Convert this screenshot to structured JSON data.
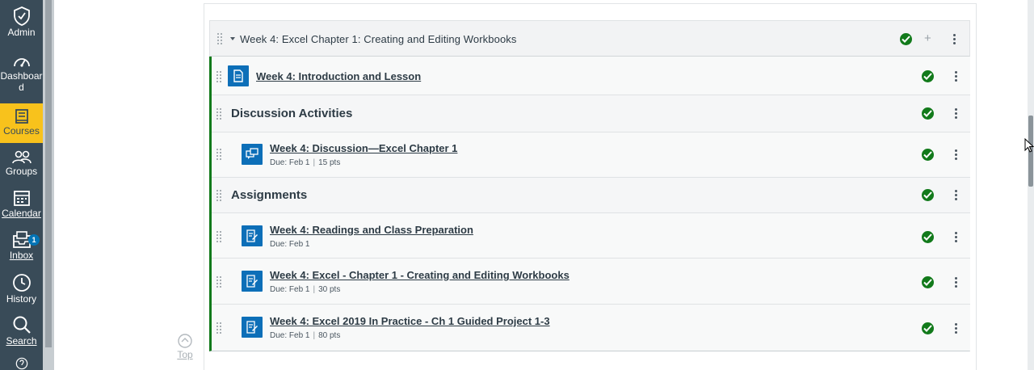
{
  "global_nav": {
    "items": [
      {
        "label": "Admin",
        "icon": "shield-icon"
      },
      {
        "label": "Dashboard",
        "label_lines": [
          "Dashboar",
          "d"
        ],
        "icon": "dashboard-icon"
      },
      {
        "label": "Courses",
        "icon": "book-icon",
        "active": true
      },
      {
        "label": "Groups",
        "icon": "groups-icon"
      },
      {
        "label": "Calendar",
        "icon": "calendar-icon"
      },
      {
        "label": "Inbox",
        "icon": "inbox-icon",
        "badge": "1"
      },
      {
        "label": "History",
        "icon": "clock-icon"
      },
      {
        "label": "Search",
        "icon": "search-icon"
      },
      {
        "label": "Help",
        "icon": "help-icon"
      }
    ]
  },
  "back_to_top": {
    "label": "Top"
  },
  "module": {
    "title": "Week 4: Excel Chapter 1: Creating and Editing Workbooks",
    "published": true,
    "items": [
      {
        "kind": "item",
        "title": "Week 4: Introduction and Lesson",
        "icon": "page-icon"
      },
      {
        "kind": "subheader",
        "title": "Discussion Activities"
      },
      {
        "kind": "item",
        "title": "Week 4: Discussion—Excel Chapter 1",
        "icon": "discussion-icon",
        "due": "Due: Feb 1",
        "points": "15 pts"
      },
      {
        "kind": "subheader",
        "title": "Assignments"
      },
      {
        "kind": "item",
        "title": "Week 4: Readings and Class Preparation",
        "icon": "assignment-icon",
        "due": "Due: Feb 1"
      },
      {
        "kind": "item",
        "title": "Week 4: Excel - Chapter 1 - Creating and Editing Workbooks",
        "icon": "assignment-icon",
        "due": "Due: Feb 1",
        "points": "30 pts"
      },
      {
        "kind": "item",
        "title": "Week 4: Excel 2019 In Practice - Ch 1 Guided Project 1-3",
        "icon": "assignment-icon",
        "due": "Due: Feb 1",
        "points": "80 pts"
      }
    ]
  },
  "colors": {
    "nav_bg": "#394b58",
    "nav_active": "#f8c21c",
    "published_green": "#127a1b",
    "icon_blue": "#0d6fb8"
  }
}
